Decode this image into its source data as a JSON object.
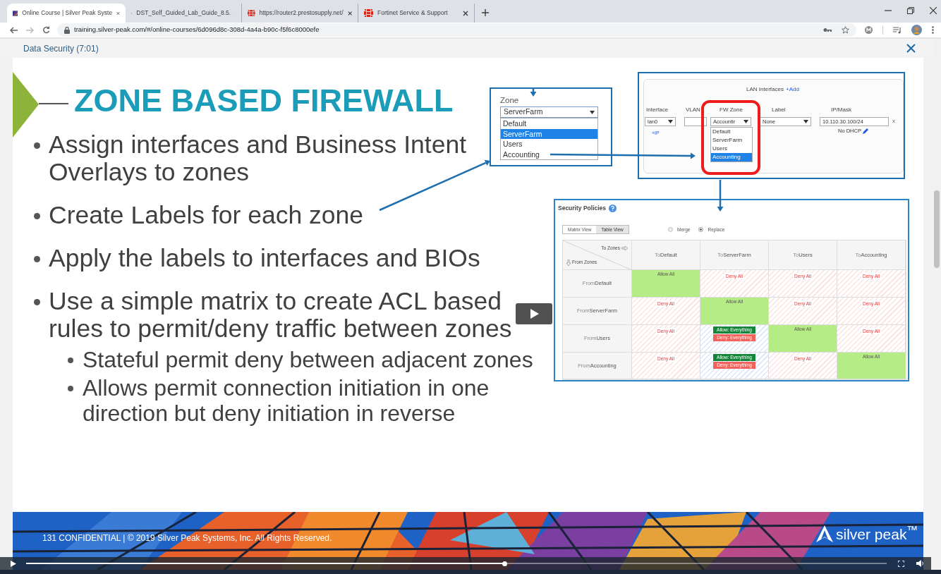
{
  "browser": {
    "tabs": [
      {
        "title": "Online Course | Silver Peak Syste",
        "selected": true
      },
      {
        "title": "DST_Self_Guided_Lab_Guide_8.5.",
        "selected": false
      },
      {
        "title": "https://router2.prestosupply.net/",
        "selected": false
      },
      {
        "title": "Fortinet Service & Support",
        "selected": false
      }
    ],
    "address": "training.silver-peak.com/#/online-courses/6d096d8c-308d-4a4a-b90c-f5f6c8000efe"
  },
  "modal": {
    "title": "Data Security (7:01)"
  },
  "slide": {
    "title": "ZONE BASED FIREWALL",
    "bullets": [
      {
        "text": "Assign interfaces and Business Intent Overlays to zones"
      },
      {
        "text": "Create Labels for each zone"
      },
      {
        "text": "Apply the labels to interfaces and BIOs"
      },
      {
        "text": "Use a simple matrix to create ACL based rules to permit/deny traffic between zones",
        "children": [
          {
            "text": "Stateful permit deny between adjacent zones"
          },
          {
            "text": "Allows permit connection initiation in one direction but deny initiation in reverse"
          }
        ]
      }
    ],
    "zone_dropdown": {
      "label": "Zone",
      "value": "ServerFarm",
      "options": [
        {
          "label": "Default",
          "selected": false
        },
        {
          "label": "ServerFarm",
          "selected": true
        },
        {
          "label": "Users",
          "selected": false
        },
        {
          "label": "Accounting",
          "selected": false
        }
      ]
    },
    "lan_interfaces": {
      "title": "LAN Interfaces",
      "add": "+Add",
      "columns": [
        "Interface",
        "VLAN",
        "FW Zone",
        "Label",
        "IP/Mask"
      ],
      "interface": "lan0",
      "fw_zone": "Accountir",
      "label": "None",
      "ip": "10.110.30.100/24",
      "remove": "x",
      "add_ip": "+IP",
      "dhcp": "No DHCP",
      "fw_zone_options": [
        {
          "label": "Default",
          "selected": false
        },
        {
          "label": "ServerFarm",
          "selected": false
        },
        {
          "label": "Users",
          "selected": false
        },
        {
          "label": "Accounting",
          "selected": true
        }
      ]
    },
    "security_policies": {
      "title": "Security Policies",
      "views": [
        {
          "label": "Matrix View",
          "selected": false
        },
        {
          "label": "Table View",
          "selected": true
        }
      ],
      "modes": [
        {
          "label": "Merge",
          "selected": false
        },
        {
          "label": "Replace",
          "selected": true
        }
      ],
      "to_zones": "To Zones",
      "from_zones": "From Zones",
      "columns": [
        {
          "prefix": "To",
          "name": "Default"
        },
        {
          "prefix": "To",
          "name": "ServerFarm"
        },
        {
          "prefix": "To",
          "name": "Users"
        },
        {
          "prefix": "To",
          "name": "Accounting"
        }
      ],
      "rows": [
        {
          "prefix": "From",
          "name": "Default",
          "cells": [
            {
              "kind": "allow",
              "text": "Allow All"
            },
            {
              "kind": "deny",
              "text": "Deny All"
            },
            {
              "kind": "deny",
              "text": "Deny All"
            },
            {
              "kind": "deny",
              "text": "Deny All"
            }
          ]
        },
        {
          "prefix": "From",
          "name": "ServerFarm",
          "cells": [
            {
              "kind": "deny",
              "text": "Deny All"
            },
            {
              "kind": "allow",
              "text": "Allow All"
            },
            {
              "kind": "deny",
              "text": "Deny All"
            },
            {
              "kind": "deny",
              "text": "Deny All"
            }
          ]
        },
        {
          "prefix": "From",
          "name": "Users",
          "cells": [
            {
              "kind": "deny",
              "text": "Deny All"
            },
            {
              "kind": "rules",
              "badges": [
                {
                  "kind": "allow",
                  "text": "Allow: Everything"
                },
                {
                  "kind": "deny",
                  "text": "Deny: Everything"
                }
              ]
            },
            {
              "kind": "allow",
              "text": "Allow All"
            },
            {
              "kind": "deny",
              "text": "Deny All"
            }
          ]
        },
        {
          "prefix": "From",
          "name": "Accounting",
          "cells": [
            {
              "kind": "deny",
              "text": "Deny All"
            },
            {
              "kind": "rules",
              "badges": [
                {
                  "kind": "allow",
                  "text": "Allow: Everything"
                },
                {
                  "kind": "deny",
                  "text": "Deny: Everything"
                }
              ]
            },
            {
              "kind": "deny",
              "text": "Deny All"
            },
            {
              "kind": "allow",
              "text": "Allow All"
            }
          ]
        }
      ]
    },
    "footer": {
      "text": "131 CONFIDENTIAL | © 2019 Silver Peak Systems, Inc. All Rights Reserved.",
      "logo": "silver peak",
      "logo_mark": "™"
    }
  },
  "player": {
    "level": 0.556
  }
}
